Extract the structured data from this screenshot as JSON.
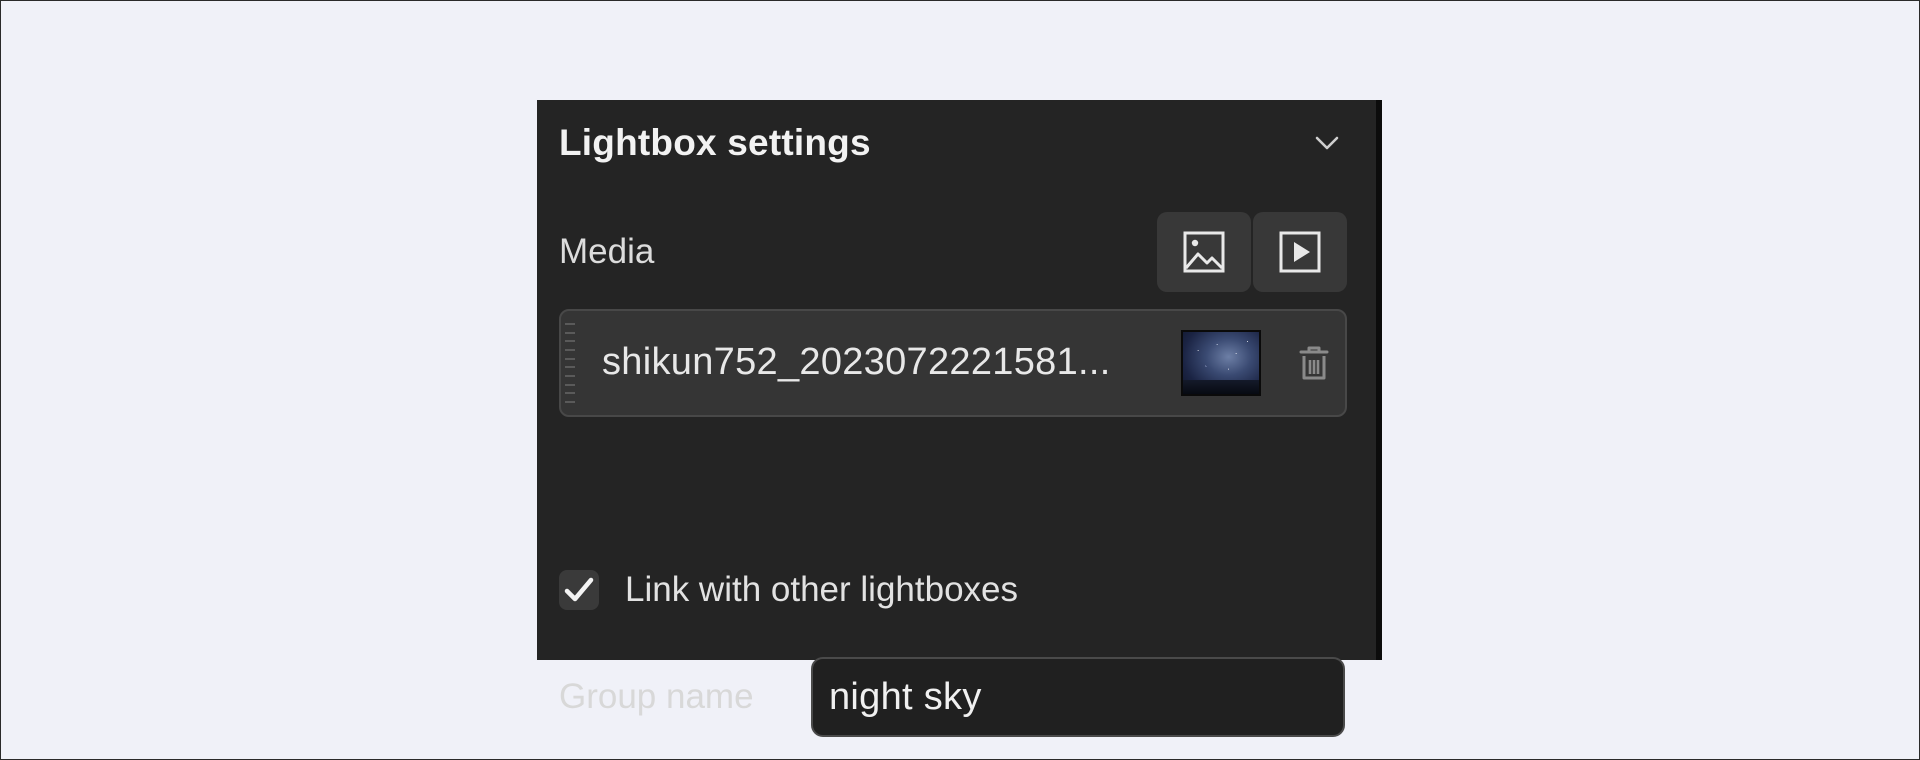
{
  "panel": {
    "title": "Lightbox settings",
    "collapse_icon": "chevron-down-icon"
  },
  "media": {
    "label": "Media",
    "buttons": [
      {
        "icon": "image-icon"
      },
      {
        "icon": "video-play-icon"
      }
    ],
    "file": {
      "name": "shikun752_2023072221581...",
      "thumbnail_icon": "night-sky-thumbnail",
      "delete_icon": "trash-icon"
    }
  },
  "link": {
    "label": "Link with other lightboxes",
    "checked": true
  },
  "group": {
    "label": "Group name",
    "value": "night sky"
  },
  "colors": {
    "page_background": "#f0f1f8",
    "panel_background": "#242424",
    "button_background": "#383838",
    "item_background": "#353535",
    "text_primary": "#e6e6e6"
  }
}
